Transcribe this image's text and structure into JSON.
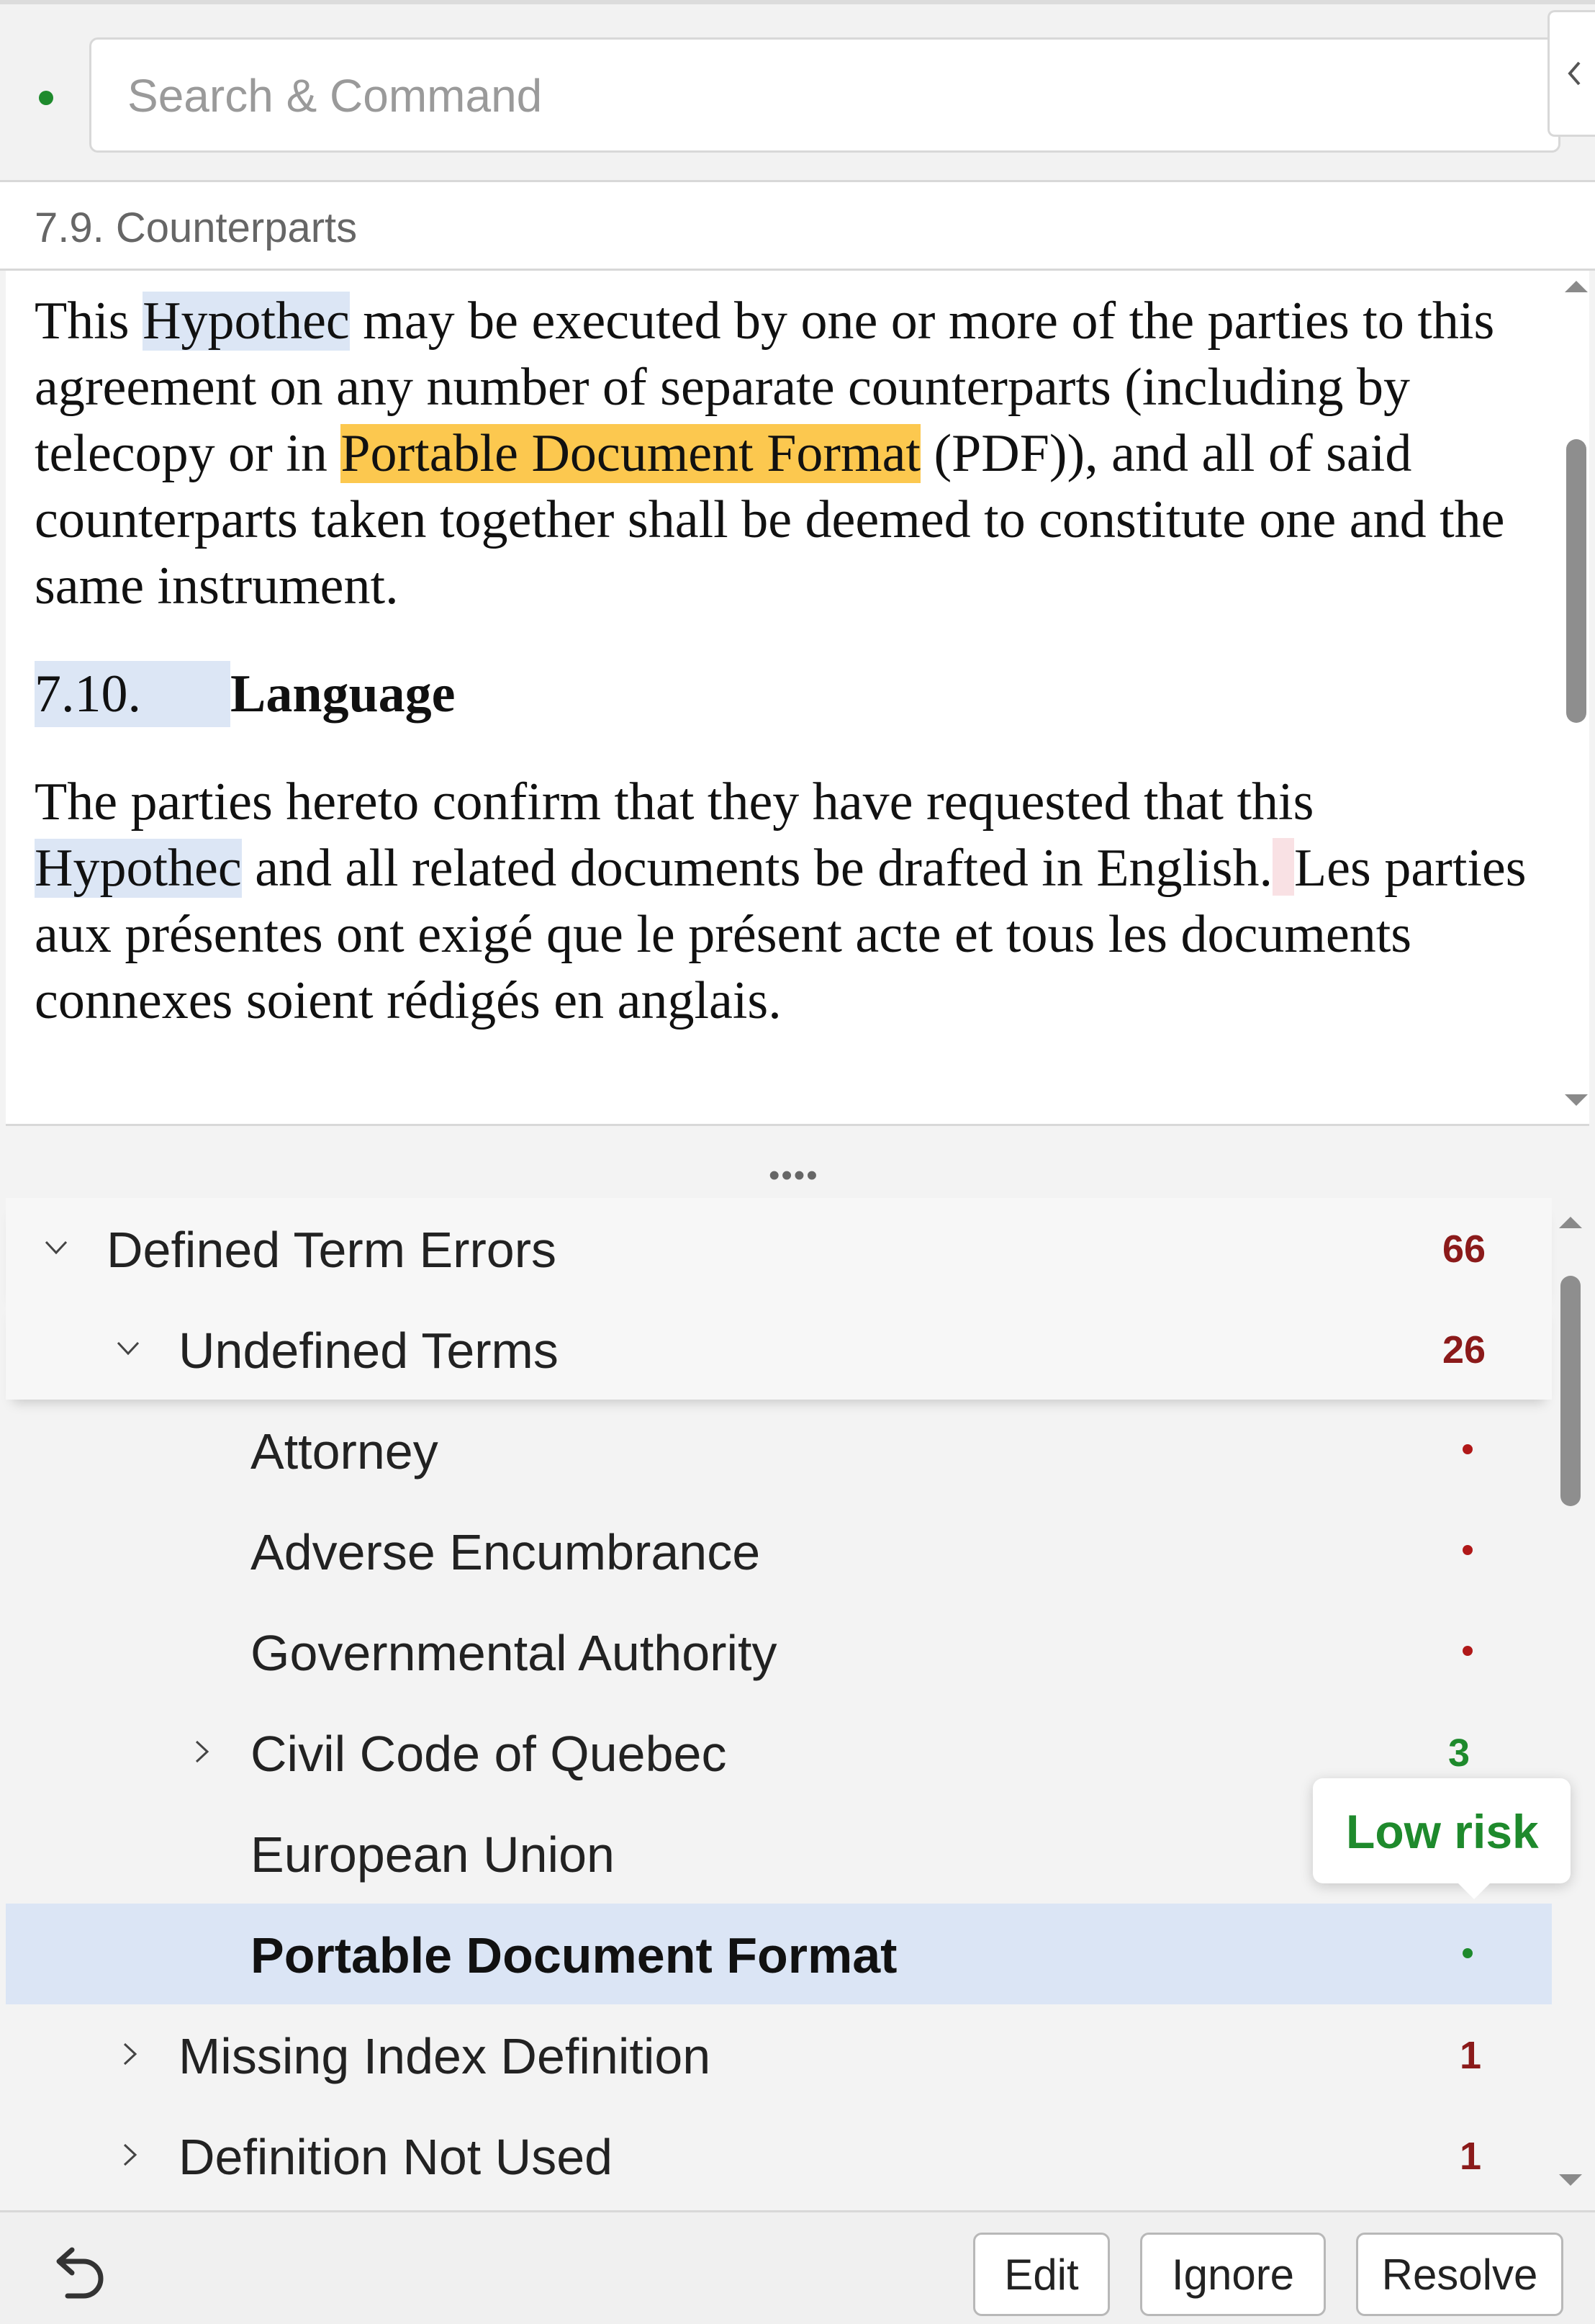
{
  "search": {
    "placeholder": "Search & Command"
  },
  "breadcrumb": {
    "text": "7.9. Counterparts"
  },
  "document": {
    "p1_pre": "This ",
    "p1_term1": "Hypothec",
    "p1_mid1": " may be executed by one or more of the parties to this agreement on any number of separate counterparts (including by telecopy or in ",
    "p1_term2": "Portable Document Format",
    "p1_post": " (PDF)), and all of said counterparts taken together shall be deemed to constitute one and the same instrument.",
    "section_number": "7.10.",
    "section_title": "Language",
    "p3_pre": "The parties hereto confirm that they have requested that this ",
    "p3_term": "Hypothec",
    "p3_mid": " and all related documents be drafted in English.",
    "p3_post": "Les parties aux présentes ont exigé que le présent acte et tous les documents connexes soient rédigés en anglais."
  },
  "splitter": {
    "grip": "••••"
  },
  "tree": {
    "items": [
      {
        "label": "Defined Term Errors",
        "count": "66",
        "status": "red"
      },
      {
        "label": "Undefined Terms",
        "count": "26",
        "status": "red"
      },
      {
        "label": "Attorney",
        "status": "red"
      },
      {
        "label": "Adverse Encumbrance",
        "status": "red"
      },
      {
        "label": "Governmental Authority",
        "status": "red"
      },
      {
        "label": "Civil Code of Quebec",
        "count": "3",
        "status": "green"
      },
      {
        "label": "European Union",
        "status": "green"
      },
      {
        "label": "Portable Document Format",
        "status": "green",
        "selected": true
      },
      {
        "label": "Missing Index Definition",
        "count": "1",
        "status": "red"
      },
      {
        "label": "Definition Not Used",
        "count": "1",
        "status": "red"
      }
    ]
  },
  "tooltip": {
    "text": "Low risk"
  },
  "toolbar": {
    "edit_label": "Edit",
    "ignore_label": "Ignore",
    "resolve_label": "Resolve"
  },
  "colors": {
    "accent_green": "#1e8a2c",
    "error_red": "#8b1a1a",
    "selection_blue": "#dbe5f5",
    "highlight_yellow": "#fcc84f"
  },
  "icons": [
    "status-dot-icon",
    "chevron-left-icon",
    "chevron-down-icon",
    "chevron-right-icon",
    "undo-icon"
  ]
}
